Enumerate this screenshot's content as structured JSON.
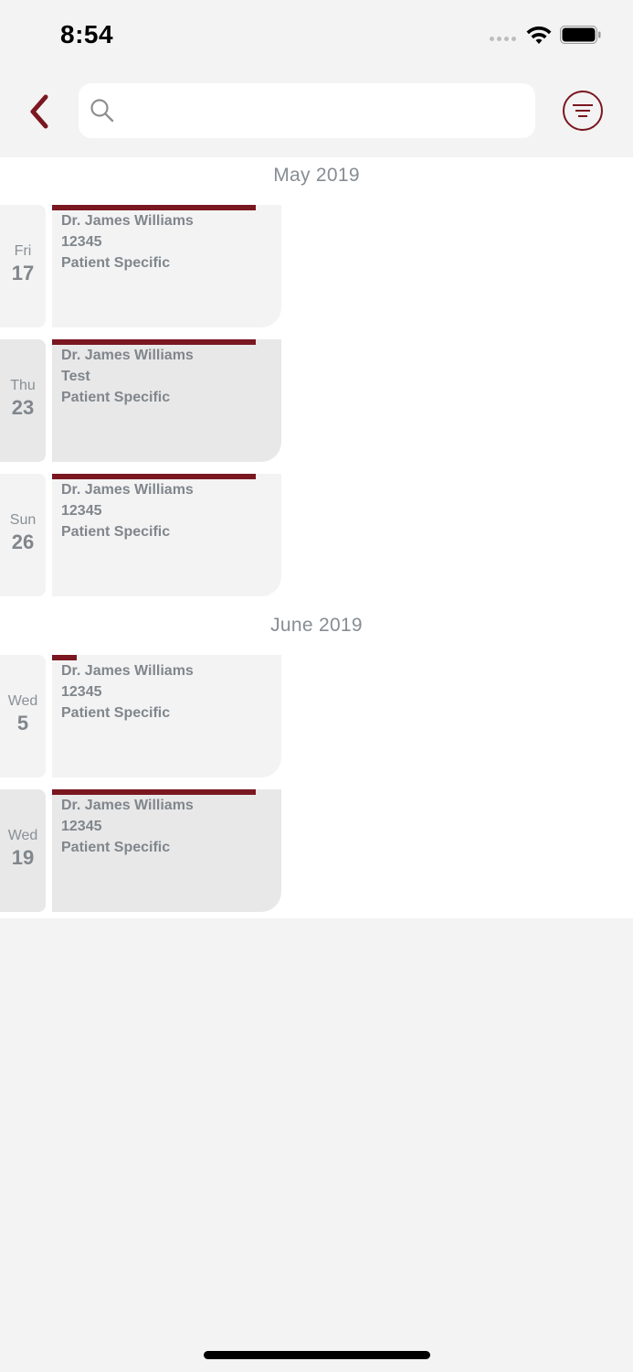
{
  "status_bar": {
    "time": "8:54"
  },
  "search": {
    "placeholder": ""
  },
  "months": [
    {
      "label": "May 2019"
    },
    {
      "label": "June 2019"
    }
  ],
  "events": [
    {
      "day": "Fri",
      "date": "17",
      "doctor": "Dr. James Williams",
      "detail": "12345",
      "type": "Patient Specific",
      "progress": 1.0
    },
    {
      "day": "Thu",
      "date": "23",
      "doctor": "Dr. James Williams",
      "detail": "Test",
      "type": "Patient Specific",
      "progress": 1.0
    },
    {
      "day": "Sun",
      "date": "26",
      "doctor": "Dr. James Williams",
      "detail": "12345",
      "type": "Patient Specific",
      "progress": 1.0
    },
    {
      "day": "Wed",
      "date": "5",
      "doctor": "Dr. James Williams",
      "detail": "12345",
      "type": "Patient Specific",
      "progress": 0.12
    },
    {
      "day": "Wed",
      "date": "19",
      "doctor": "Dr. James Williams",
      "detail": "12345",
      "type": "Patient Specific",
      "progress": 1.0
    }
  ],
  "colors": {
    "accent": "#7a1720",
    "text_muted": "#80868c",
    "background": "#f3f3f3"
  }
}
